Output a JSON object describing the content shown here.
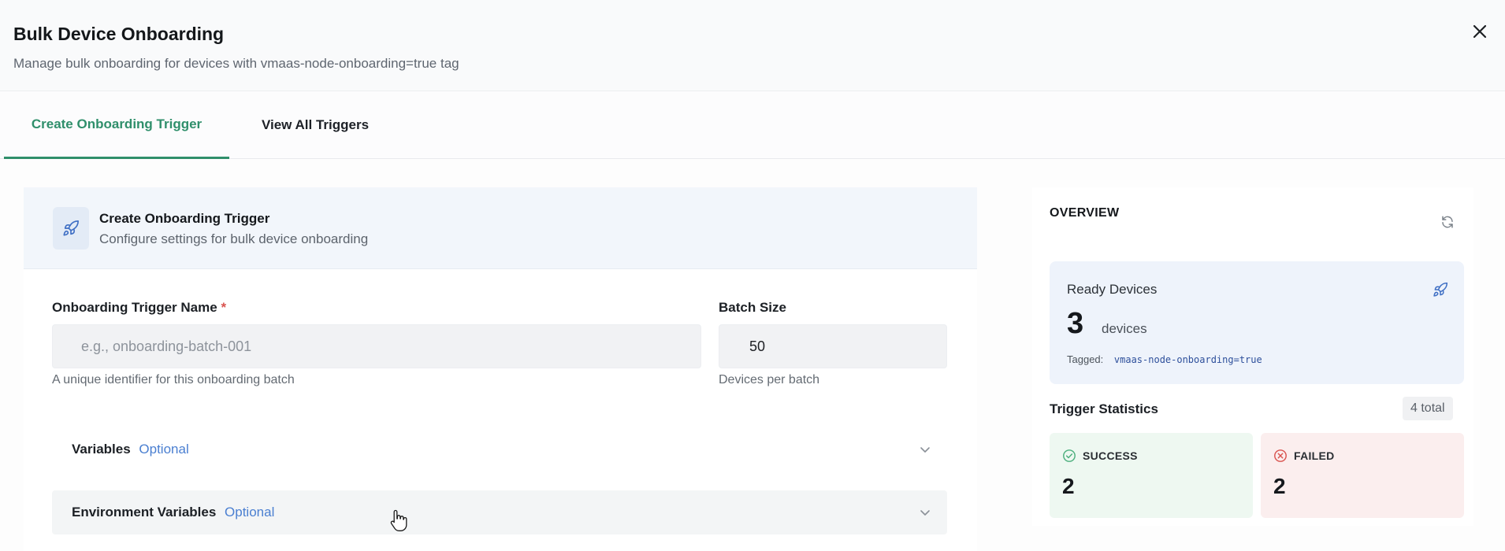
{
  "header": {
    "title": "Bulk Device Onboarding",
    "subtitle": "Manage bulk onboarding for devices with vmaas-node-onboarding=true tag",
    "close_icon": "close-icon"
  },
  "tabs": [
    {
      "label": "Create Onboarding Trigger",
      "active": true
    },
    {
      "label": "View All Triggers",
      "active": false
    }
  ],
  "form": {
    "title": "Create Onboarding Trigger",
    "subtitle": "Configure settings for bulk device onboarding",
    "icon": "rocket-icon",
    "name_field": {
      "label": "Onboarding Trigger Name",
      "required_mark": "*",
      "placeholder": "e.g., onboarding-batch-001",
      "value": "",
      "helper": "A unique identifier for this onboarding batch"
    },
    "batch_field": {
      "label": "Batch Size",
      "value": "50",
      "helper": "Devices per batch"
    },
    "sections": [
      {
        "label": "Variables",
        "optional": "Optional"
      },
      {
        "label": "Environment Variables",
        "optional": "Optional"
      }
    ]
  },
  "overview": {
    "title": "OVERVIEW",
    "refresh_icon": "refresh-icon",
    "ready": {
      "label": "Ready Devices",
      "count": "3",
      "unit": "devices",
      "tagged_label": "Tagged:",
      "tag": "vmaas-node-onboarding=true",
      "icon": "rocket-icon"
    },
    "stats": {
      "title": "Trigger Statistics",
      "total": "4 total",
      "success_label": "SUCCESS",
      "success_value": "2",
      "failed_label": "FAILED",
      "failed_value": "2"
    }
  },
  "colors": {
    "accent": "#2f8f6b",
    "link": "#4a7fd1",
    "success": "#4caf7d",
    "failed": "#d9534f"
  }
}
